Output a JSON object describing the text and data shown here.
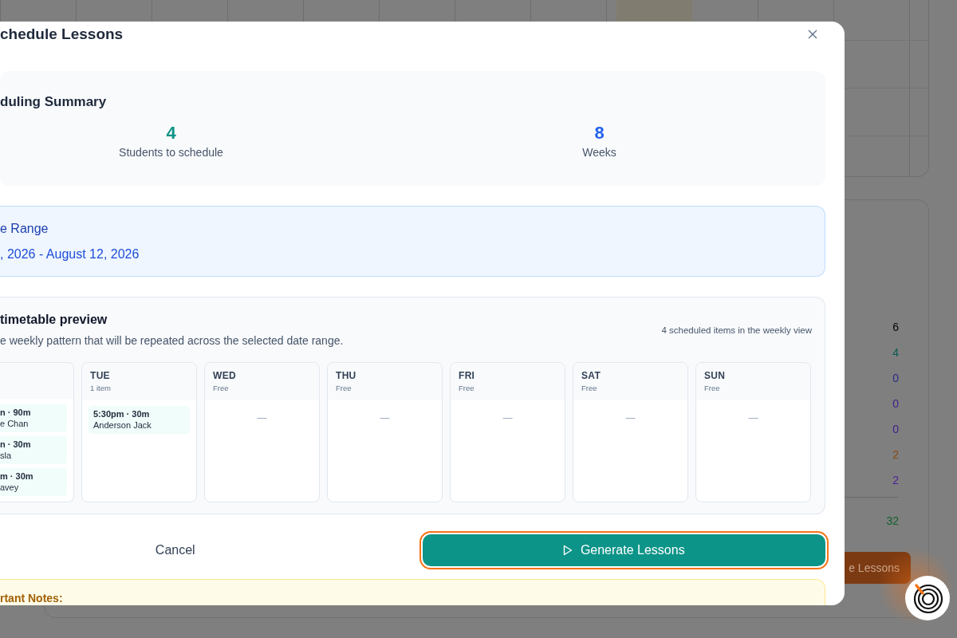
{
  "background": {
    "stats": [
      {
        "value": "6",
        "color": "#050505"
      },
      {
        "value": "4",
        "color": "#0b5a4f"
      },
      {
        "value": "0",
        "color": "#2c2a8a"
      },
      {
        "value": "0",
        "color": "#3f1f8a"
      },
      {
        "value": "0",
        "color": "#3f1f8a"
      },
      {
        "value": "2",
        "color": "#8a4a10"
      },
      {
        "value": "2",
        "color": "#4a1f9a"
      }
    ],
    "total": {
      "value": "32",
      "color": "#14612e"
    },
    "button": "e Lessons"
  },
  "modal": {
    "title": "chedule Lessons",
    "summary": {
      "title": "duling Summary",
      "stats": [
        {
          "value": "4",
          "label": "Students to schedule",
          "color": "#0d9488"
        },
        {
          "value": "8",
          "label": "Weeks",
          "color": "#2563eb"
        }
      ]
    },
    "date_range": {
      "title": "e Range",
      "value": ", 2026 - August 12, 2026"
    },
    "timetable": {
      "title": "timetable preview",
      "description": "e weekly pattern that will be repeated across the selected date range.",
      "count": "4 scheduled items in the weekly view",
      "days": [
        {
          "items": [
            {
              "time": "n · 90m",
              "name": "e Chan"
            },
            {
              "time": "n · 30m",
              "name": "sla"
            },
            {
              "time": "m · 30m",
              "name": "avey"
            }
          ]
        },
        {
          "day": "TUE",
          "status": "1 item",
          "items": [
            {
              "time": "5:30pm · 30m",
              "name": "Anderson Jack"
            }
          ]
        },
        {
          "day": "WED",
          "status": "Free",
          "empty": "—"
        },
        {
          "day": "THU",
          "status": "Free",
          "empty": "—"
        },
        {
          "day": "FRI",
          "status": "Free",
          "empty": "—"
        },
        {
          "day": "SAT",
          "status": "Free",
          "empty": "—"
        },
        {
          "day": "SUN",
          "status": "Free",
          "empty": "—"
        }
      ]
    },
    "buttons": {
      "cancel": "Cancel",
      "generate": {
        "label": "Generate Lessons",
        "focused": true
      }
    },
    "notes": {
      "title": "rtant Notes:"
    }
  }
}
